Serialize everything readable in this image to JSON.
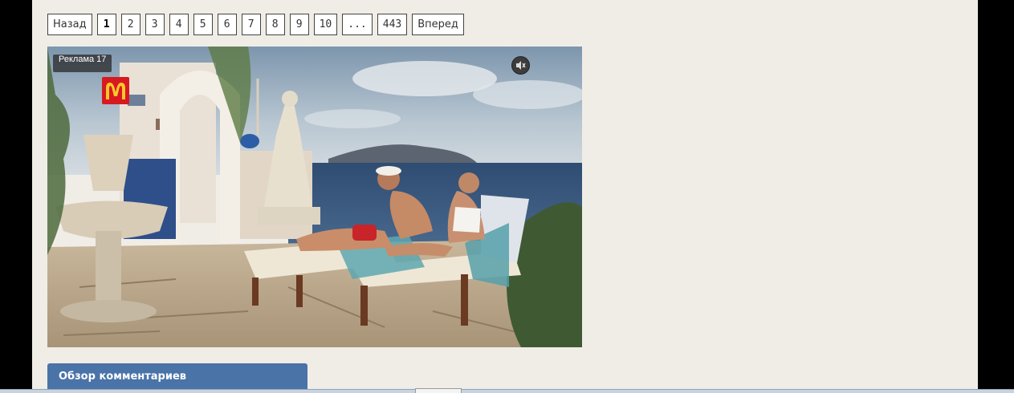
{
  "pagination": {
    "prev_label": "Назад",
    "pages": [
      "1",
      "2",
      "3",
      "4",
      "5",
      "6",
      "7",
      "8",
      "9",
      "10"
    ],
    "current_page": "1",
    "ellipsis": "...",
    "last_page": "443",
    "next_label": "Вперед"
  },
  "ad": {
    "label": "Реклама 17",
    "logo_icon": "mcdonalds-logo",
    "mute_icon": "speaker-muted-icon"
  },
  "comments": {
    "title": "Обзор комментариев"
  },
  "colors": {
    "page_bg": "#f0ede7",
    "accent_blue": "#4a73a8",
    "logo_red": "#d71920",
    "logo_yellow": "#ffc72c"
  }
}
